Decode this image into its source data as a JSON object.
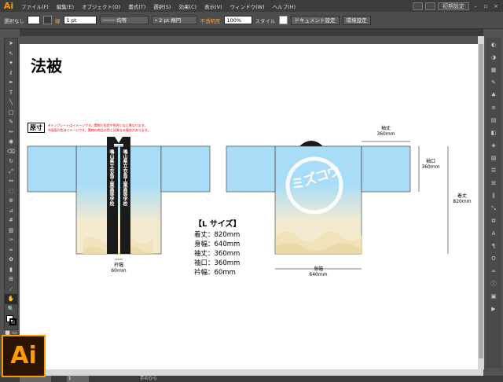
{
  "app": {
    "logo": "Ai",
    "badge": "Ai"
  },
  "menubar": {
    "items": [
      "ファイル(F)",
      "編集(E)",
      "オブジェクト(O)",
      "書式(T)",
      "選択(S)",
      "効果(C)",
      "表示(V)",
      "ウィンドウ(W)",
      "ヘルプ(H)"
    ],
    "workspace": "初期設定"
  },
  "control_bar": {
    "selection_label": "選択なし",
    "stroke_label": "線",
    "stroke_weight": "1 pt",
    "profile_label": "均等",
    "brush_label": "2 pt 楕円",
    "opacity_label": "不透明度",
    "opacity_value": "100%",
    "style_label": "スタイル",
    "doc_setup_button": "ドキュメント設定",
    "prefs_button": "環境設定"
  },
  "status": {
    "tool_name": "手のひら",
    "page": "1"
  },
  "doc": {
    "title": "法被",
    "gensun": "原寸",
    "note1": "※テンプレートはイメージです。実物と形状や色合いなど異なります。",
    "note2": "※画面の色はイメージです。実物の商品の色とは異なる場合があります。",
    "size_heading": "【L サイズ】",
    "sizes": [
      "着丈：820mm",
      "身幅：640mm",
      "袖丈：360mm",
      "袖口：360mm",
      "衿幅：60mm"
    ],
    "collar_text": "鳴山県立衣島工業高等学校",
    "dims": {
      "eri_label": "衿幅",
      "eri_value": "60mm",
      "sodetake_label": "袖丈",
      "sodetake_value": "360mm",
      "sodeguchi_label": "袖口",
      "sodeguchi_value": "360mm",
      "kitake_label": "着丈",
      "kitake_value": "820mm",
      "mihaba_label": "身幅",
      "mihaba_value": "640mm"
    },
    "logo_text": "ミズコウ"
  },
  "colors": {
    "sky": "#a9dcf6",
    "sand": "#f5ebcc",
    "collar": "#1a1a1a",
    "accent": "#ff9a00"
  }
}
